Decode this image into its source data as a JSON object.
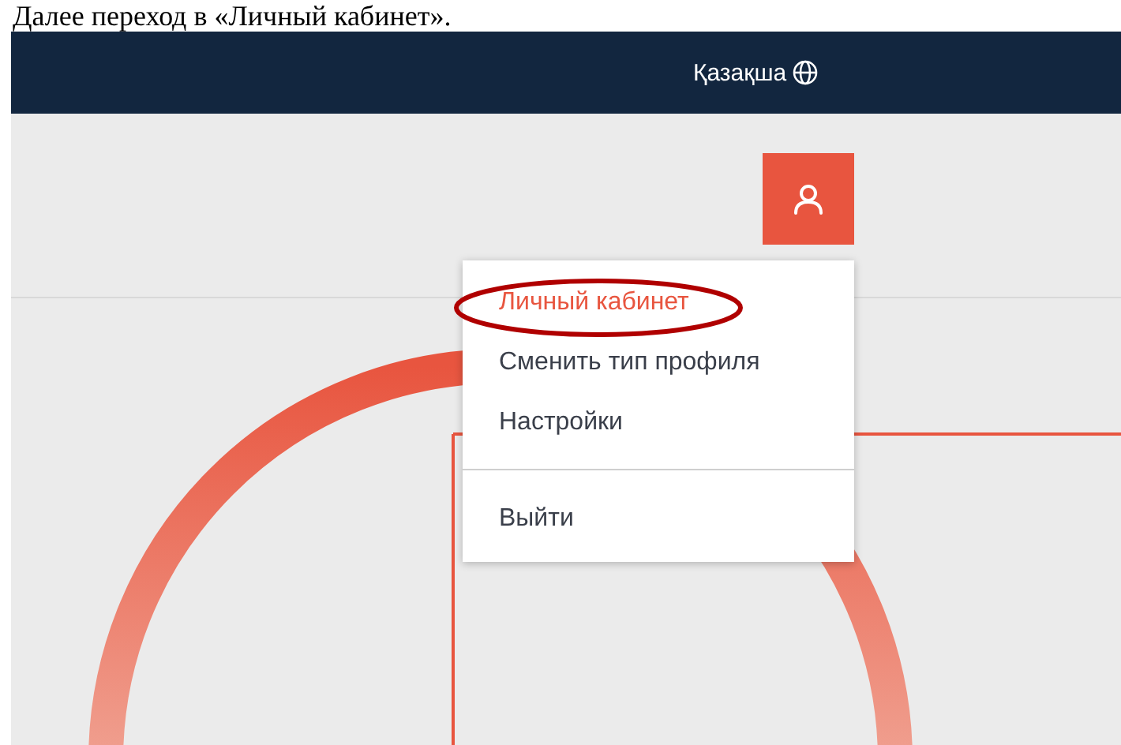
{
  "document_text": "Далее переход в «Личный кабинет».",
  "header": {
    "language": "Қазақша"
  },
  "user_menu": {
    "open": true,
    "items": [
      {
        "label": "Личный кабинет",
        "selected": true,
        "annotated": true
      },
      {
        "label": "Сменить тип профиля",
        "selected": false,
        "annotated": false
      },
      {
        "label": "Настройки",
        "selected": false,
        "annotated": false
      },
      {
        "kind": "divider"
      },
      {
        "label": "Выйти",
        "selected": false,
        "annotated": false
      }
    ]
  }
}
